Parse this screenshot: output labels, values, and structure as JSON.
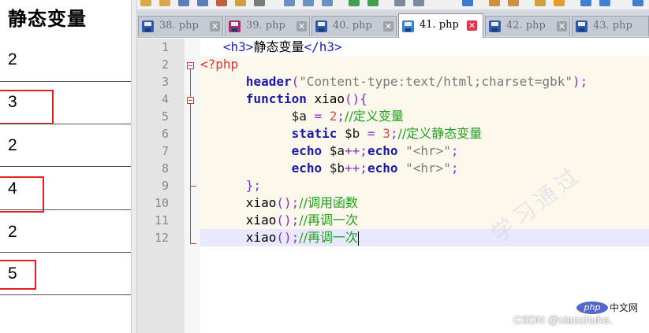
{
  "output_panel": {
    "heading": "静态变量",
    "values": [
      "2",
      "3",
      "2",
      "4",
      "2",
      "5"
    ]
  },
  "tabs": [
    {
      "label": "38. php",
      "active": false
    },
    {
      "label": "39. php",
      "active": false
    },
    {
      "label": "40. php",
      "active": false
    },
    {
      "label": "41. php",
      "active": true
    },
    {
      "label": "42. php",
      "active": false
    },
    {
      "label": "43. php",
      "active": false
    }
  ],
  "tab_close_glyph": "✕",
  "line_numbers": [
    "1",
    "2",
    "3",
    "4",
    "5",
    "6",
    "7",
    "8",
    "9",
    "10",
    "11",
    "12"
  ],
  "code": {
    "l1": {
      "open": "<h3>",
      "text": "静态变量",
      "close": "</h3>"
    },
    "l2": {
      "tag": "<?php"
    },
    "l3": {
      "fn": "header",
      "open": "(",
      "str": "\"Content-type:text/html;charset=gbk\"",
      "close": ");"
    },
    "l4": {
      "kw": "function",
      "name": " xiao",
      "parens": "(){"
    },
    "l5": {
      "var": "$a",
      "op": " = ",
      "num": "2",
      "semi": ";",
      "comment": "//定义变量"
    },
    "l6": {
      "kw": "static",
      "var": " $b",
      "op": " = ",
      "num": "3",
      "semi": ";",
      "comment": "//定义静态变量"
    },
    "l7": {
      "kw1": "echo",
      "var": " $a",
      "op": "++;",
      "kw2": "echo",
      "str": " \"<hr>\"",
      "semi": ";"
    },
    "l8": {
      "kw1": "echo",
      "var": " $b",
      "op": "++;",
      "kw2": "echo",
      "str": " \"<hr>\"",
      "semi": ";"
    },
    "l9": {
      "text": "};"
    },
    "l10": {
      "name": "xiao",
      "parens": "();",
      "comment": "//调用函数"
    },
    "l11": {
      "name": "xiao",
      "parens": "();",
      "comment": "//再调一次"
    },
    "l12": {
      "name": "xiao",
      "parens": "();",
      "comment": "//再调一次"
    }
  },
  "watermarks": {
    "diagonal": "学习通过",
    "php_badge": "php",
    "php_cn": "中文网",
    "csdn": "CSDN @xiaochuhe."
  },
  "colors": {
    "active_tab_close": "#e0384a",
    "output_highlight_box": "#e02020",
    "fold_marker": "#e03030",
    "keyword": "#1a1aa8",
    "comment": "#20a020",
    "html_tag": "#2020c0"
  }
}
